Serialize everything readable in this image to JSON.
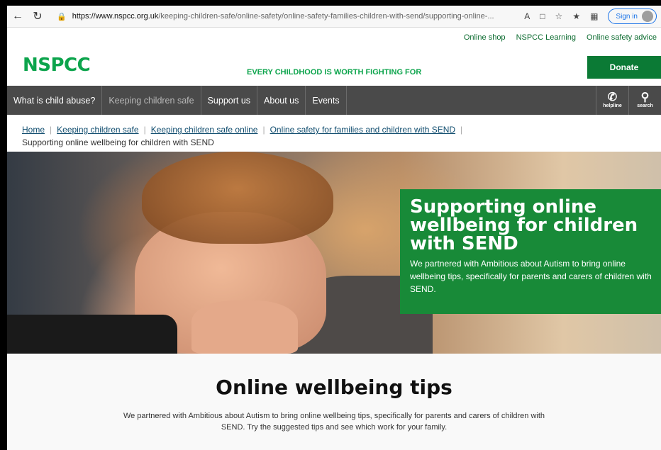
{
  "browser": {
    "url_host": "https://www.nspcc.org.uk",
    "url_rest": "/keeping-children-safe/online-safety/online-safety-families-children-with-send/supporting-online-...",
    "signin_label": "Sign in"
  },
  "toplinks": [
    "Online shop",
    "NSPCC Learning",
    "Online safety advice"
  ],
  "header": {
    "logo": "NSPCC",
    "tagline": "EVERY CHILDHOOD IS WORTH FIGHTING FOR",
    "donate_label": "Donate"
  },
  "mainnav": {
    "items": [
      "What is child abuse?",
      "Keeping children safe",
      "Support us",
      "About us",
      "Events"
    ],
    "helpline_label": "helpline",
    "search_label": "search"
  },
  "breadcrumb": {
    "items": [
      "Home",
      "Keeping children safe",
      "Keeping children safe online",
      "Online safety for families and children with SEND"
    ],
    "current": "Supporting online wellbeing for children with SEND"
  },
  "hero": {
    "title": "Supporting online wellbeing for children with SEND",
    "text": "We partnered with Ambitious about Autism to bring online wellbeing tips, specifically for parents and carers of children with SEND."
  },
  "tips": {
    "heading": "Online wellbeing tips",
    "text": "We partnered with Ambitious about Autism to bring online wellbeing tips, specifically for parents and carers of children with SEND. Try the suggested tips and see which work for your family."
  },
  "colors": {
    "brand_green": "#0ca44c",
    "donate_green": "#0b7a35",
    "hero_panel": "#188a38",
    "nav_bg": "#4a4a4a"
  }
}
